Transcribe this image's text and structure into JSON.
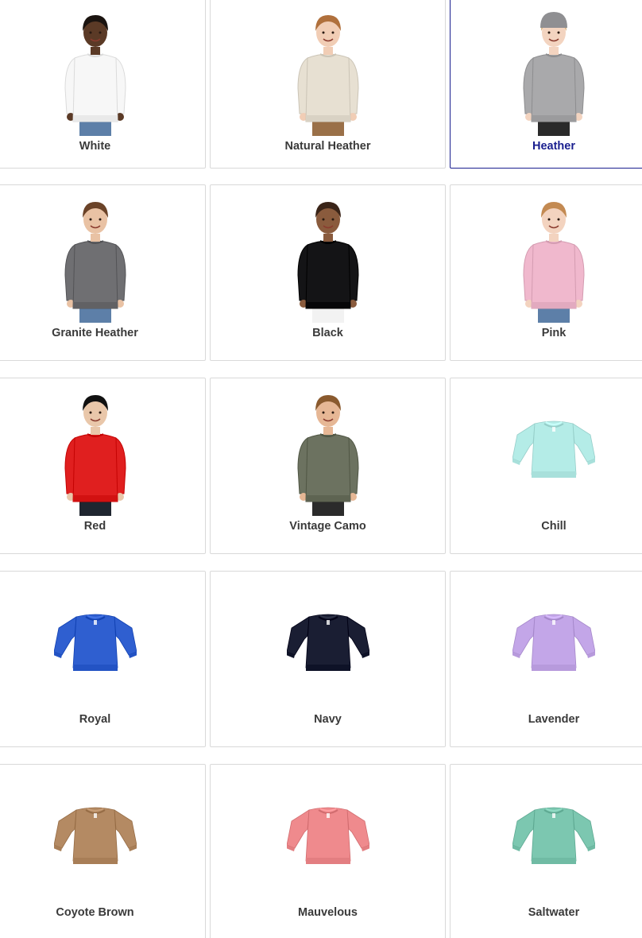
{
  "selected_color": "Heather",
  "colors": [
    {
      "name": "White",
      "swatch": "#f7f7f7",
      "image": "child-model",
      "skin": "#5b3a26",
      "hair": "#1b1410",
      "pants": "#5d7fa8"
    },
    {
      "name": "Natural Heather",
      "swatch": "#e7e0d2",
      "image": "child-model",
      "skin": "#f1cdb5",
      "hair": "#b0703c",
      "pants": "#9a7048"
    },
    {
      "name": "Heather",
      "swatch": "#a9a9ab",
      "image": "child-model",
      "skin": "#f3d4c0",
      "hair": "#d6b17b",
      "pants": "#2a2a2a",
      "hat": "#8f8f92"
    },
    {
      "name": "Granite Heather",
      "swatch": "#6f6f72",
      "image": "child-model",
      "skin": "#e9c2a4",
      "hair": "#6b4328",
      "pants": "#5d7fa8"
    },
    {
      "name": "Black",
      "swatch": "#141416",
      "image": "child-model",
      "skin": "#8a5b3d",
      "hair": "#3a2418",
      "pants": "#f2f2f2"
    },
    {
      "name": "Pink",
      "swatch": "#f0b8cd",
      "image": "child-model",
      "skin": "#f3d3bf",
      "hair": "#c38a52",
      "pants": "#5d7fa8"
    },
    {
      "name": "Red",
      "swatch": "#e01f1f",
      "image": "child-model",
      "skin": "#e9c7aa",
      "hair": "#111111",
      "pants": "#1f2630"
    },
    {
      "name": "Vintage Camo",
      "swatch": "#6c7260",
      "image": "child-model",
      "skin": "#e6b795",
      "hair": "#8a5a2e",
      "pants": "#2b2b2b"
    },
    {
      "name": "Chill",
      "swatch": "#b4ece7",
      "image": "flat-sweatshirt"
    },
    {
      "name": "Royal",
      "swatch": "#2f5fd0",
      "image": "flat-sweatshirt"
    },
    {
      "name": "Navy",
      "swatch": "#1a1e33",
      "image": "flat-sweatshirt"
    },
    {
      "name": "Lavender",
      "swatch": "#c3a6e8",
      "image": "flat-sweatshirt"
    },
    {
      "name": "Coyote Brown",
      "swatch": "#b48a63",
      "image": "flat-sweatshirt"
    },
    {
      "name": "Mauvelous",
      "swatch": "#ef8a8d",
      "image": "flat-sweatshirt"
    },
    {
      "name": "Saltwater",
      "swatch": "#7cc7b0",
      "image": "flat-sweatshirt"
    }
  ]
}
